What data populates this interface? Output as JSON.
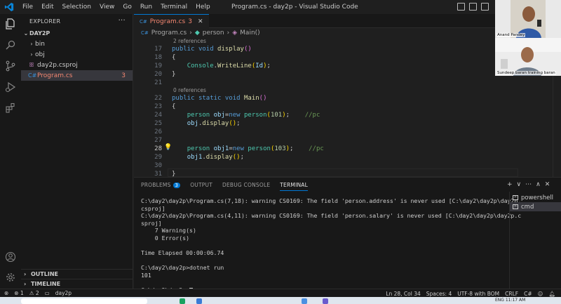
{
  "window": {
    "title": "Program.cs - day2p - Visual Studio Code",
    "menu": [
      "File",
      "Edit",
      "Selection",
      "View",
      "Go",
      "Run",
      "Terminal",
      "Help"
    ]
  },
  "explorer": {
    "header": "EXPLORER",
    "more": "···",
    "folder": "DAY2P",
    "items": [
      {
        "label": "bin",
        "type": "folder"
      },
      {
        "label": "obj",
        "type": "folder"
      },
      {
        "label": "day2p.csproj",
        "type": "file"
      },
      {
        "label": "Program.cs",
        "type": "file",
        "badge": "3"
      }
    ],
    "outline": "OUTLINE",
    "timeline": "TIMELINE"
  },
  "editor": {
    "tab_label": "Program.cs",
    "tab_badge": "3",
    "breadcrumb": [
      "Program.cs",
      "person",
      "Main()"
    ],
    "lens_display": "2 references",
    "lens_main": "0 references",
    "lines": [
      {
        "n": "17",
        "text": "public void display()"
      },
      {
        "n": "18",
        "text": "{"
      },
      {
        "n": "19",
        "text": "Console.WriteLine(Id);"
      },
      {
        "n": "20",
        "text": "}"
      },
      {
        "n": "21",
        "text": ""
      },
      {
        "n": "22",
        "text": "public static void Main()"
      },
      {
        "n": "23",
        "text": "{"
      },
      {
        "n": "24",
        "text": "person obj=new person(101);    //pc"
      },
      {
        "n": "25",
        "text": "obj.display();"
      },
      {
        "n": "26",
        "text": ""
      },
      {
        "n": "27",
        "text": ""
      },
      {
        "n": "28",
        "text": "person obj1=new person(103);    //pc"
      },
      {
        "n": "29",
        "text": "obj1.display();"
      },
      {
        "n": "30",
        "text": ""
      },
      {
        "n": "31",
        "text": "}"
      }
    ]
  },
  "video": {
    "top_name": "Anand Pandey",
    "bottom_name": "Sundeep baran training baran"
  },
  "panel": {
    "tabs": [
      "PROBLEMS",
      "OUTPUT",
      "DEBUG CONSOLE",
      "TERMINAL"
    ],
    "problems_count": "3",
    "terminal_lines": [
      "C:\\day2\\day2p\\Program.cs(7,18): warning CS0169: The field 'person.address' is never used [C:\\day2\\day2p\\day2p.",
      "csproj]",
      "C:\\day2\\day2p\\Program.cs(4,11): warning CS0169: The field 'person.salary' is never used [C:\\day2\\day2p\\day2p.c",
      "sproj]",
      "    7 Warning(s)",
      "    0 Error(s)",
      "",
      "Time Elapsed 00:00:06.74",
      "",
      "C:\\day2\\day2p>dotnet run",
      "101",
      "",
      "C:\\day2\\day2p>"
    ],
    "terminals": [
      "powershell",
      "cmd"
    ],
    "actions": [
      "+",
      "∨",
      "⋯",
      "∧",
      "✕"
    ]
  },
  "status": {
    "errors": "⊗ 1",
    "warnings": "⚠ 2",
    "project": "day2p",
    "position": "Ln 28, Col 34",
    "spaces": "Spaces: 4",
    "encoding": "UTF-8 with BOM",
    "eol": "CRLF",
    "language": "C#"
  },
  "taskbar": {
    "tray": "ENG   11:17 AM"
  },
  "colors": {
    "accent": "#0078d4",
    "error": "#f48771",
    "editor_bg": "#1f1f1f",
    "sidebar_bg": "#181818"
  }
}
